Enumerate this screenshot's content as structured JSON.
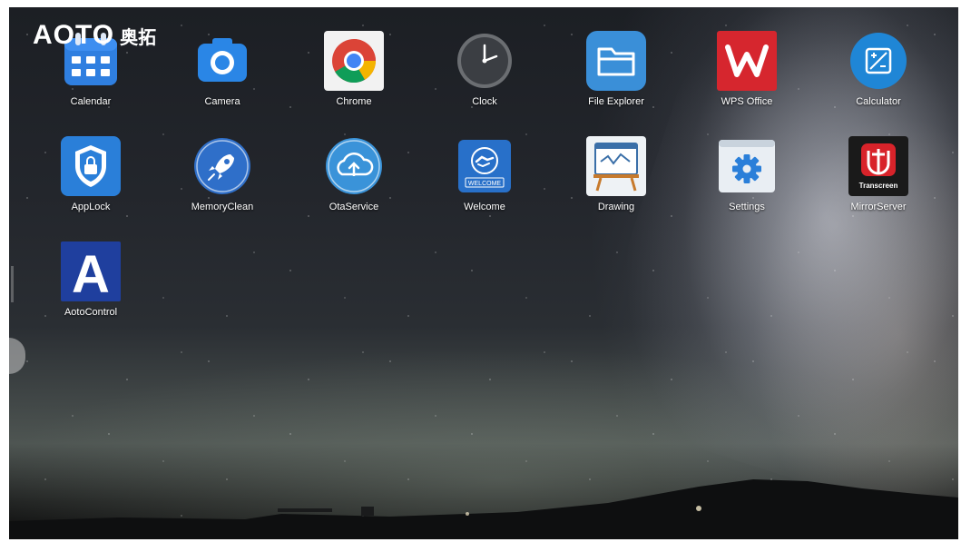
{
  "brand": {
    "logo_latin": "AOTO",
    "logo_cjk": "奥拓"
  },
  "apps": [
    {
      "label": "Calendar",
      "icon": "calendar-icon"
    },
    {
      "label": "Camera",
      "icon": "camera-icon"
    },
    {
      "label": "Chrome",
      "icon": "chrome-icon"
    },
    {
      "label": "Clock",
      "icon": "clock-icon"
    },
    {
      "label": "File Explorer",
      "icon": "folder-icon"
    },
    {
      "label": "WPS Office",
      "icon": "wps-office-icon"
    },
    {
      "label": "Calculator",
      "icon": "calculator-icon"
    },
    {
      "label": "AppLock",
      "icon": "shield-lock-icon"
    },
    {
      "label": "MemoryClean",
      "icon": "rocket-icon"
    },
    {
      "label": "OtaService",
      "icon": "cloud-upload-icon"
    },
    {
      "label": "Welcome",
      "icon": "welcome-handshake-icon",
      "badge": "WELCOME"
    },
    {
      "label": "Drawing",
      "icon": "whiteboard-icon"
    },
    {
      "label": "Settings",
      "icon": "gear-icon"
    },
    {
      "label": "MirrorServer",
      "icon": "transcreen-icon",
      "badge": "Transcreen"
    },
    {
      "label": "AotoControl",
      "icon": "aoto-a-icon",
      "glyph": "A"
    }
  ],
  "colors": {
    "calendar_blue": "#2f7fe0",
    "camera_blue": "#2a86e6",
    "folder_blue": "#3a8fd8",
    "wps_red": "#d6262e",
    "calculator_blue": "#1f86d6",
    "applock_blue": "#2a7fd9",
    "aoto_blue": "#1f3f9e",
    "transcreen_red": "#d8232a"
  }
}
